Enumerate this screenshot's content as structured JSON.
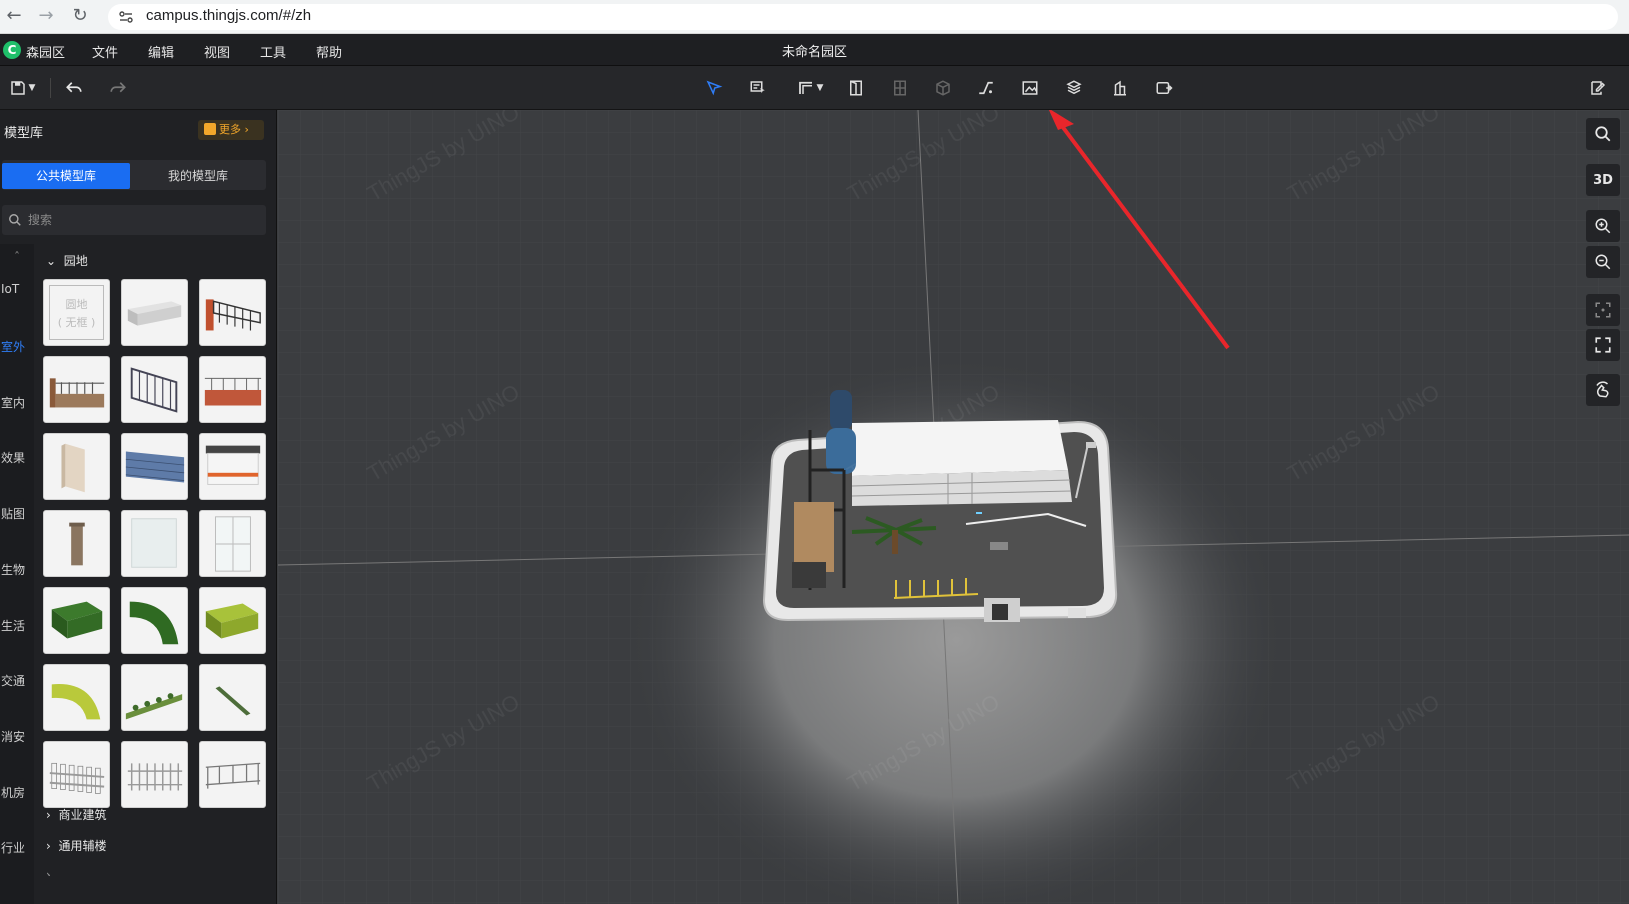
{
  "browser": {
    "url": "campus.thingjs.com/#/zh"
  },
  "menubar": {
    "app_name": "森园区",
    "menus": [
      "文件",
      "编辑",
      "视图",
      "工具",
      "帮助"
    ],
    "doc_title": "未命名园区"
  },
  "left_panel": {
    "title": "模型库",
    "more_label": "更多",
    "tabs": [
      "公共模型库",
      "我的模型库"
    ],
    "search_placeholder": "搜索",
    "categories": [
      "IoT",
      "室外",
      "室内",
      "效果",
      "贴图",
      "生物",
      "生活",
      "交通",
      "消安",
      "机房",
      "行业"
    ],
    "active_category": "室外",
    "group_title": "园地",
    "thumb_text_line1": "圆地",
    "thumb_text_line2": "( 无框 )",
    "sub_groups": [
      "商业建筑",
      "通用辅楼"
    ]
  },
  "viewport": {
    "watermark": "ThingJS by UINO",
    "view_mode": "3D"
  },
  "colors": {
    "accent": "#1a6df2",
    "more_orange": "#f2a72b",
    "annotation_arrow": "#e8262b"
  }
}
